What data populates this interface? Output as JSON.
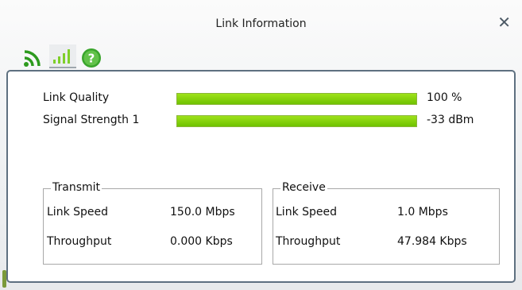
{
  "window": {
    "title": "Link Information"
  },
  "toolbar": {
    "icons": [
      "wifi-signal-icon",
      "signal-bars-icon",
      "help-icon"
    ]
  },
  "link": {
    "quality_label": "Link Quality",
    "quality_value": "100 %",
    "quality_percent": 100,
    "signal_label": "Signal Strength 1",
    "signal_value": "-33 dBm",
    "signal_percent": 100
  },
  "transmit": {
    "title": "Transmit",
    "link_speed_label": "Link Speed",
    "link_speed_value": "150.0 Mbps",
    "throughput_label": "Throughput",
    "throughput_value": "0.000 Kbps"
  },
  "receive": {
    "title": "Receive",
    "link_speed_label": "Link Speed",
    "link_speed_value": "1.0 Mbps",
    "throughput_label": "Throughput",
    "throughput_value": "47.984 Kbps"
  },
  "colors": {
    "bar_green": "#7ccf00",
    "panel_border": "#5e7080",
    "icon_green": "#2d9a1e"
  }
}
